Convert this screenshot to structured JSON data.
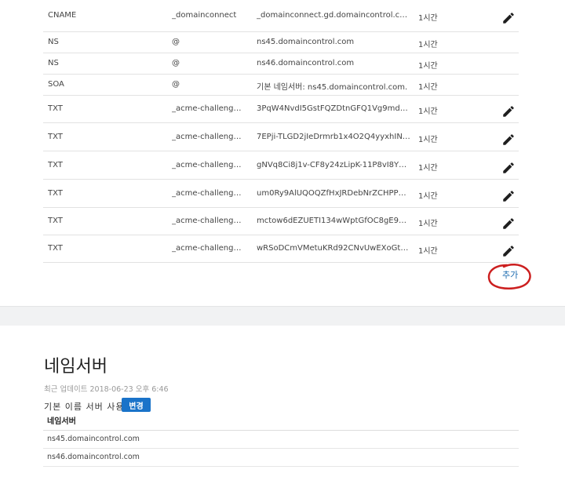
{
  "records": [
    {
      "type": "CNAME",
      "name": "_domainconnect",
      "data": "_domainconnect.gd.domaincontrol.com",
      "ttl": "1시간",
      "editable": true
    },
    {
      "type": "NS",
      "name": "@",
      "data": "ns45.domaincontrol.com",
      "ttl": "1시간",
      "editable": false
    },
    {
      "type": "NS",
      "name": "@",
      "data": "ns46.domaincontrol.com",
      "ttl": "1시간",
      "editable": false
    },
    {
      "type": "SOA",
      "name": "@",
      "data": "기본 네임서버: ns45.domaincontrol.com.",
      "ttl": "1시간",
      "editable": false
    },
    {
      "type": "TXT",
      "name": "_acme-challenge.codi...",
      "data": "3PqW4NvdI5GstFQZDtnGFQ1Vg9mdMvAaCur...",
      "ttl": "1시간",
      "editable": true
    },
    {
      "type": "TXT",
      "name": "_acme-challenge.codi...",
      "data": "7EPji-TLGD2jIeDrmrb1x4O2Q4yyxhINZnvd1Of...",
      "ttl": "1시간",
      "editable": true
    },
    {
      "type": "TXT",
      "name": "_acme-challenge.codi...",
      "data": "gNVq8Ci8j1v-CF8y24zLipK-11P8vI8YTiQcvMr...",
      "ttl": "1시간",
      "editable": true
    },
    {
      "type": "TXT",
      "name": "_acme-challenge.codi...",
      "data": "um0Ry9AlUQOQZfHxJRDebNrZCHPPy1UlEnb_...",
      "ttl": "1시간",
      "editable": true
    },
    {
      "type": "TXT",
      "name": "_acme-challenge.codi...",
      "data": "mctow6dEZUETI134wWptGfOC8gE9q_oyCrkBv...",
      "ttl": "1시간",
      "editable": true
    },
    {
      "type": "TXT",
      "name": "_acme-challenge.codi...",
      "data": "wRSoDCmVMetuKRd92CNvUwEXoGt_xG_JjKa2...",
      "ttl": "1시간",
      "editable": true
    }
  ],
  "add_label": "추가",
  "nameserver": {
    "title": "네임서버",
    "updated": "최근 업데이트 2018-06-23 오후 6:46",
    "default_label": "기본 이름 서버 사용",
    "change_label": "변경",
    "column_header": "네임서버",
    "servers": [
      "ns45.domaincontrol.com",
      "ns46.domaincontrol.com"
    ]
  },
  "colors": {
    "accent": "#1a73c9",
    "annotation": "#cc1f1f",
    "link": "#1b6bb0"
  },
  "icons": {
    "edit": "pencil-icon"
  }
}
